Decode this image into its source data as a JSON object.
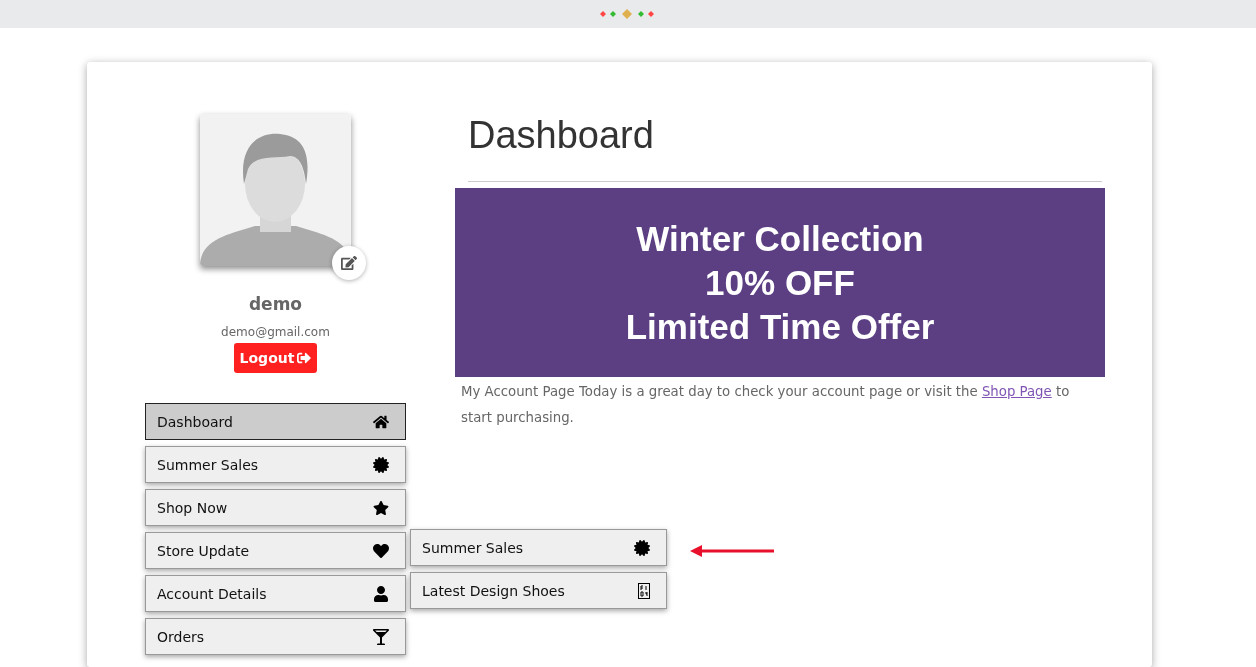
{
  "profile": {
    "name": "demo",
    "email": "demo@gmail.com",
    "logout": "Logout"
  },
  "menu": [
    {
      "label": "Dashboard",
      "kind": "home",
      "selected": true
    },
    {
      "label": "Summer Sales",
      "kind": "certificate",
      "selected": false
    },
    {
      "label": "Shop Now",
      "kind": "star",
      "selected": false
    },
    {
      "label": "Store Update",
      "kind": "heart",
      "selected": false,
      "expanded": true,
      "children": [
        {
          "label": "Summer Sales",
          "kind": "certificate"
        },
        {
          "label": "Latest Design Shoes",
          "kind": "missing"
        }
      ]
    },
    {
      "label": "Account Details",
      "kind": "user",
      "selected": false
    },
    {
      "label": "Orders",
      "kind": "glass",
      "selected": false
    }
  ],
  "content": {
    "title": "Dashboard",
    "banner": [
      "Winter Collection",
      "10% OFF",
      "Limited Time Offer"
    ],
    "paragraph": {
      "before": "My Account Page Today is a great day to check your account page or visit the ",
      "link": "Shop Page",
      "after": " to start purchasing."
    }
  }
}
